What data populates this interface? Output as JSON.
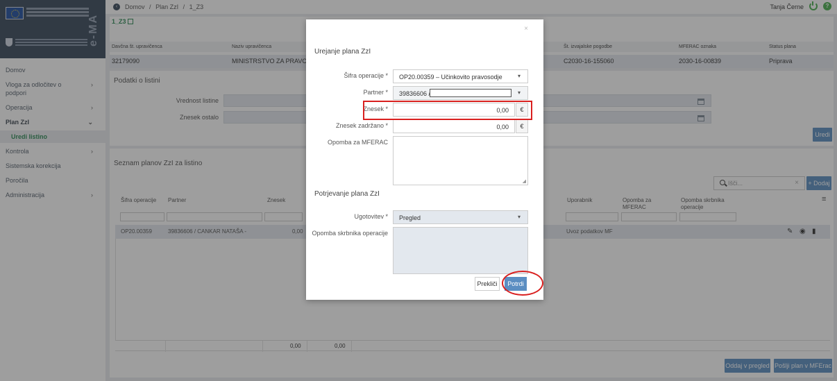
{
  "brand": {
    "logo_text": "e-MA"
  },
  "nav": {
    "items": [
      {
        "label": "Domov",
        "arrow": ""
      },
      {
        "label": "Vloga za odločitev o podpori",
        "arrow": "›"
      },
      {
        "label": "Operacija",
        "arrow": "›"
      },
      {
        "label": "Plan ZzI",
        "arrow": "⌄"
      },
      {
        "label": "Uredi listino",
        "arrow": ""
      },
      {
        "label": "Kontrola",
        "arrow": "›"
      },
      {
        "label": "Sistemska korekcija",
        "arrow": ""
      },
      {
        "label": "Poročila",
        "arrow": ""
      },
      {
        "label": "Administracija",
        "arrow": "›"
      }
    ]
  },
  "topbar": {
    "breadcrumb": [
      "Domov",
      "/",
      "Plan ZzI",
      "/",
      "1_Z3"
    ],
    "user": "Tanja Černe"
  },
  "info": {
    "plan_title": "1_Z3",
    "headers": [
      "Davčna št. upravičenca",
      "Naziv upravičenca",
      "Št. izvajalske pogodbe",
      "MFERAC oznaka",
      "Status plana"
    ],
    "values": [
      "32179090",
      "MINISTRSTVO ZA PRAVOSODJE",
      "C2030-16-155060",
      "2030-16-00839",
      "Priprava"
    ]
  },
  "podatki": {
    "title": "Podatki o listini",
    "vrednost_label": "Vrednost listine",
    "znesek_ostalo_label": "Znesek ostalo",
    "uredi_button": "Uredi"
  },
  "seznam": {
    "title": "Seznam planov ZzI za listino",
    "search_placeholder": "Išči...",
    "add_button": "+ Dodaj",
    "columns": [
      "Šifra operacije",
      "Partner",
      "Znesek",
      "Uporabnik",
      "Opomba za MFERAC",
      "Opomba skrbnika operacije"
    ],
    "row": {
      "sifra": "OP20.00359",
      "partner": "39836606 / CANKAR NATAŠA -",
      "znesek": "0,00",
      "uporabnik": "Uvoz podatkov MF"
    },
    "footer_values": [
      "0,00",
      "0,00"
    ],
    "oddaj_button": "Oddaj v pregled",
    "poslji_button": "Pošlji plan v MFErac"
  },
  "modal": {
    "title": "Urejanje plana ZzI",
    "sifra_label": "Šifra operacije *",
    "sifra_value": "OP20.00359 –  Učinkovito pravosodje",
    "partner_label": "Partner *",
    "partner_value": "39836606  /",
    "znesek_label": "Znesek *",
    "znesek_value": "0,00",
    "znesek_zadrzano_label": "Znesek zadržano *",
    "znesek_zadrzano_value": "0,00",
    "currency": "€",
    "opomba_mferac_label": "Opomba za MFERAC",
    "potrjevanje_title": "Potrjevanje plana ZzI",
    "ugotovitev_label": "Ugotovitev *",
    "ugotovitev_value": "Pregled",
    "opomba_skrbnika_label": "Opomba skrbnika operacije",
    "cancel_button": "Prekliči",
    "confirm_button": "Potrdi",
    "close_icon": "×"
  },
  "colors": {
    "accent_green": "#2e8b57",
    "button_blue": "#5b8ec2",
    "highlight_red": "#d9201f",
    "sidebar_brand": "#3a4a5c"
  }
}
